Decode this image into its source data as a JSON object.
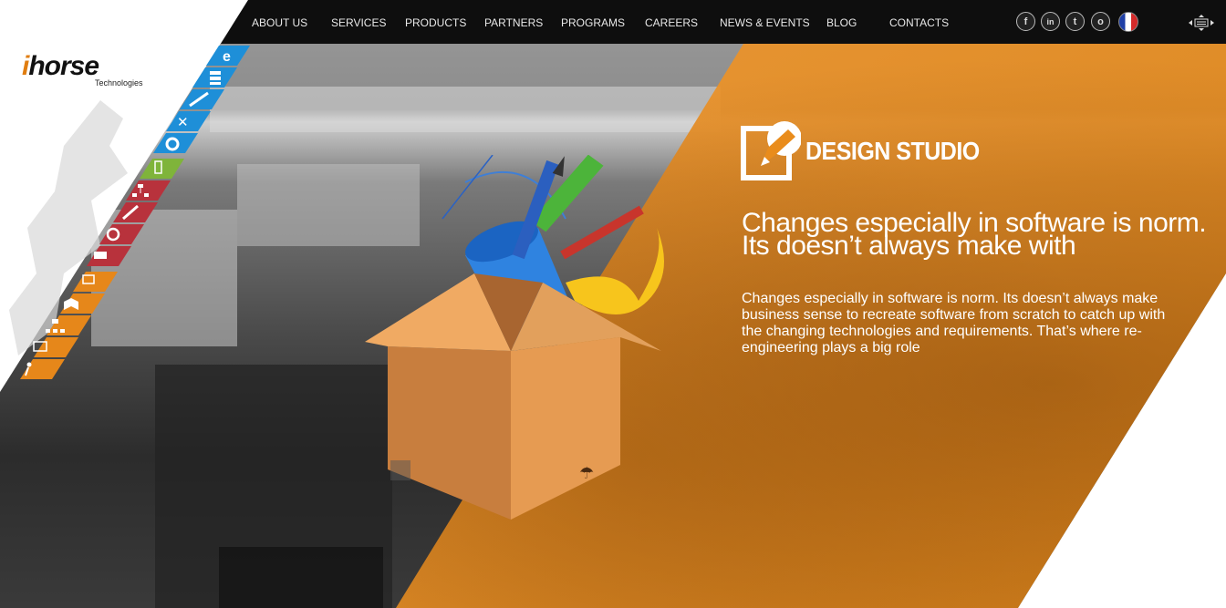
{
  "brand": {
    "logo_text_i": "i",
    "logo_text_rest": "horse",
    "logo_sub": "Technologies"
  },
  "nav": {
    "items": [
      "ABOUT US",
      "SERVICES",
      "PRODUCTS",
      "PARTNERS",
      "PROGRAMS",
      "CAREERS",
      "NEWS & EVENTS",
      "BLOG",
      "CONTACTS"
    ]
  },
  "social": {
    "facebook": "f",
    "linkedin": "in",
    "twitter": "t",
    "other": "o"
  },
  "language_flag": "french-flag-icon",
  "keyboard_icon": "⌨",
  "hero": {
    "section_title": "DESIGN STUDIO",
    "headline": "Changes especially in software is norm. Its doesn’t always make  with",
    "body": "Changes especially in software is norm. Its doesn’t always make business sense to recreate software from scratch to catch up with the changing technologies and requirements. That’s where re-engineering plays a big role"
  },
  "colors": {
    "accent_orange": "#e98c1c",
    "topbar": "#0e0e0e",
    "sidebar_blue": "#1e8fd8",
    "sidebar_green": "#7fb43a",
    "sidebar_red": "#b8323c",
    "sidebar_orange": "#e6871a"
  },
  "sidebar_icons": [
    "ie-icon",
    "server-icon",
    "pen-ruler-icon",
    "tools-icon",
    "gear-check-icon",
    "mobile-icon",
    "network-icon",
    "expand-icon",
    "robot-icon",
    "truck-icon",
    "monitor-icon",
    "cube-icon",
    "org-chart-icon",
    "presentation-icon",
    "runner-icon"
  ]
}
